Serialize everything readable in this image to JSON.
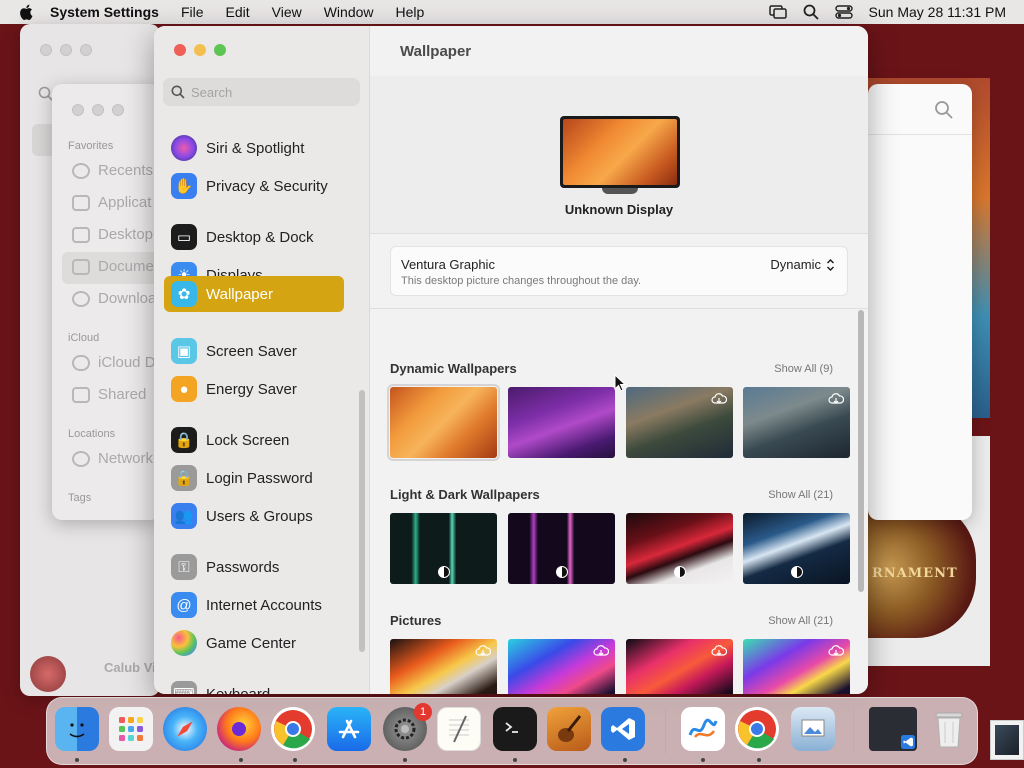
{
  "menubar": {
    "app_name": "System Settings",
    "menus": [
      "File",
      "Edit",
      "View",
      "Window",
      "Help"
    ],
    "clock": "Sun May 28  11:31 PM"
  },
  "finder_sidebar": {
    "favorites_label": "Favorites",
    "favorites": [
      "Recents",
      "Applicat",
      "Desktop",
      "Docume",
      "Downloa"
    ],
    "icloud_label": "iCloud",
    "icloud": [
      "iCloud D",
      "Shared"
    ],
    "locations_label": "Locations",
    "locations": [
      "Network"
    ],
    "tags_label": "Tags",
    "user_name": "Calub Viem"
  },
  "background_art": {
    "text": "RNAMENT"
  },
  "settings": {
    "search_placeholder": "Search",
    "nav": [
      {
        "label": "Siri & Spotlight",
        "icon": "siri-icon",
        "color": "#7b4fd8"
      },
      {
        "label": "Privacy & Security",
        "icon": "hand-icon",
        "color": "#3a7ff0"
      },
      {
        "label": "Desktop & Dock",
        "icon": "dock-icon",
        "color": "#1c1c1c"
      },
      {
        "label": "Displays",
        "icon": "sun-icon",
        "color": "#3a8cf0"
      },
      {
        "label": "Wallpaper",
        "icon": "flower-icon",
        "color": "#38b8e8",
        "selected": true
      },
      {
        "label": "Screen Saver",
        "icon": "screensaver-icon",
        "color": "#5bc7e6"
      },
      {
        "label": "Energy Saver",
        "icon": "bulb-icon",
        "color": "#f4a423"
      },
      {
        "label": "Lock Screen",
        "icon": "lock-icon",
        "color": "#1c1c1c"
      },
      {
        "label": "Login Password",
        "icon": "padlock-icon",
        "color": "#9a9a9a"
      },
      {
        "label": "Users & Groups",
        "icon": "users-icon",
        "color": "#3a7ff0"
      },
      {
        "label": "Passwords",
        "icon": "key-icon",
        "color": "#9a9a9a"
      },
      {
        "label": "Internet Accounts",
        "icon": "at-icon",
        "color": "#3a8cf0"
      },
      {
        "label": "Game Center",
        "icon": "gamecenter-icon",
        "color": "#ffffff"
      },
      {
        "label": "Keyboard",
        "icon": "keyboard-icon",
        "color": "#9a9a9a"
      }
    ],
    "page_title": "Wallpaper",
    "display_name": "Unknown Display",
    "wallpaper_name": "Ventura Graphic",
    "wallpaper_desc": "This desktop picture changes throughout the day.",
    "wallpaper_mode": "Dynamic",
    "sections": [
      {
        "title": "Dynamic Wallpapers",
        "show_all": "Show All (9)"
      },
      {
        "title": "Light & Dark Wallpapers",
        "show_all": "Show All (21)"
      },
      {
        "title": "Pictures",
        "show_all": "Show All (21)"
      }
    ]
  },
  "dock": {
    "apps": [
      "Finder",
      "Launchpad",
      "Safari",
      "Firefox",
      "Chrome",
      "App Store",
      "System Settings",
      "TextEdit",
      "Terminal",
      "GarageBand",
      "VS Code",
      "Freeform",
      "Chrome",
      "Preview"
    ],
    "settings_badge": "1"
  }
}
